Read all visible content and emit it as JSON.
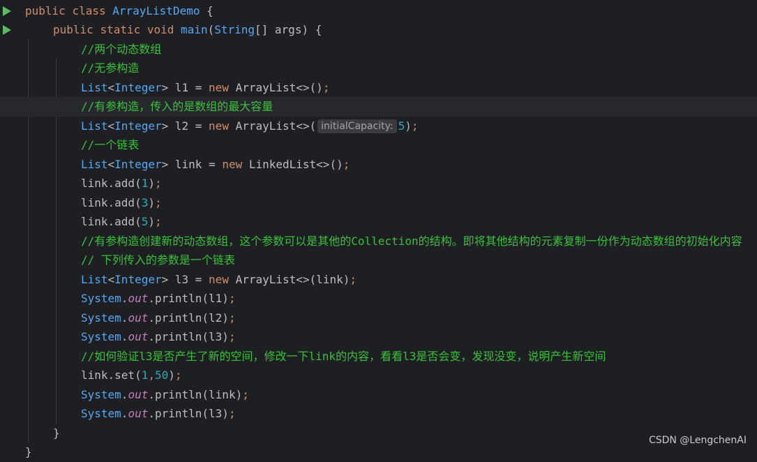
{
  "editor": {
    "lines": [
      [
        {
          "t": "public ",
          "c": "kw"
        },
        {
          "t": "class ",
          "c": "kw"
        },
        {
          "t": "ArrayListDemo",
          "c": "cls"
        },
        {
          "t": " {",
          "c": "punct"
        }
      ],
      [
        {
          "t": "public ",
          "c": "kw"
        },
        {
          "t": "static ",
          "c": "kw"
        },
        {
          "t": "void ",
          "c": "kw"
        },
        {
          "t": "main",
          "c": "fn"
        },
        {
          "t": "(",
          "c": "punct"
        },
        {
          "t": "String",
          "c": "type"
        },
        {
          "t": "[] args) {",
          "c": "punct"
        }
      ],
      [
        {
          "t": "//两个动态数组",
          "c": "cmt"
        }
      ],
      [
        {
          "t": "//无参构造",
          "c": "cmt"
        }
      ],
      [
        {
          "t": "List",
          "c": "type"
        },
        {
          "t": "<",
          "c": "punct"
        },
        {
          "t": "Integer",
          "c": "type"
        },
        {
          "t": "> l1 = ",
          "c": "punct"
        },
        {
          "t": "new ",
          "c": "kw"
        },
        {
          "t": "ArrayList<>()",
          "c": "punct"
        },
        {
          "t": ";",
          "c": "pm"
        }
      ],
      [
        {
          "t": "//有参构造，传入的是数组的最大容量",
          "c": "cmt"
        }
      ],
      [
        {
          "t": "List",
          "c": "type"
        },
        {
          "t": "<",
          "c": "punct"
        },
        {
          "t": "Integer",
          "c": "type"
        },
        {
          "t": "> l2 = ",
          "c": "punct"
        },
        {
          "t": "new ",
          "c": "kw"
        },
        {
          "t": "ArrayList<>(",
          "c": "punct"
        },
        {
          "t": "initialCapacity:",
          "c": "hint"
        },
        {
          "t": "5",
          "c": "num"
        },
        {
          "t": ")",
          "c": "punct"
        },
        {
          "t": ";",
          "c": "pm"
        }
      ],
      [
        {
          "t": "//一个链表",
          "c": "cmt"
        }
      ],
      [
        {
          "t": "List",
          "c": "type"
        },
        {
          "t": "<",
          "c": "punct"
        },
        {
          "t": "Integer",
          "c": "type"
        },
        {
          "t": "> link = ",
          "c": "punct"
        },
        {
          "t": "new ",
          "c": "kw"
        },
        {
          "t": "LinkedList<>()",
          "c": "punct"
        },
        {
          "t": ";",
          "c": "pm"
        }
      ],
      [
        {
          "t": "link.add(",
          "c": "punct"
        },
        {
          "t": "1",
          "c": "num"
        },
        {
          "t": ")",
          "c": "punct"
        },
        {
          "t": ";",
          "c": "pm"
        }
      ],
      [
        {
          "t": "link.add(",
          "c": "punct"
        },
        {
          "t": "3",
          "c": "num"
        },
        {
          "t": ")",
          "c": "punct"
        },
        {
          "t": ";",
          "c": "pm"
        }
      ],
      [
        {
          "t": "link.add(",
          "c": "punct"
        },
        {
          "t": "5",
          "c": "num"
        },
        {
          "t": ")",
          "c": "punct"
        },
        {
          "t": ";",
          "c": "pm"
        }
      ],
      [
        {
          "t": "//有参构造创建新的动态数组，这个参数可以是其他的Collection的结构。即将其他结构的元素复制一份作为动态数组的初始化内容",
          "c": "cmt"
        }
      ],
      [
        {
          "t": "// 下列传入的参数是一个链表",
          "c": "cmt"
        }
      ],
      [
        {
          "t": "List",
          "c": "type"
        },
        {
          "t": "<",
          "c": "punct"
        },
        {
          "t": "Integer",
          "c": "type"
        },
        {
          "t": "> l3 = ",
          "c": "punct"
        },
        {
          "t": "new ",
          "c": "kw"
        },
        {
          "t": "ArrayList<>(link)",
          "c": "punct"
        },
        {
          "t": ";",
          "c": "pm"
        }
      ],
      [
        {
          "t": "System",
          "c": "type"
        },
        {
          "t": ".",
          "c": "punct"
        },
        {
          "t": "out",
          "c": "field"
        },
        {
          "t": ".println(l1)",
          "c": "punct"
        },
        {
          "t": ";",
          "c": "pm"
        }
      ],
      [
        {
          "t": "System",
          "c": "type"
        },
        {
          "t": ".",
          "c": "punct"
        },
        {
          "t": "out",
          "c": "field"
        },
        {
          "t": ".println(l2)",
          "c": "punct"
        },
        {
          "t": ";",
          "c": "pm"
        }
      ],
      [
        {
          "t": "System",
          "c": "type"
        },
        {
          "t": ".",
          "c": "punct"
        },
        {
          "t": "out",
          "c": "field"
        },
        {
          "t": ".println(l3)",
          "c": "punct"
        },
        {
          "t": ";",
          "c": "pm"
        }
      ],
      [
        {
          "t": "//如何验证l3是否产生了新的空间，修改一下link的内容，看看l3是否会变，发现没变，说明产生新空间",
          "c": "cmt"
        }
      ],
      [
        {
          "t": "link.set(",
          "c": "punct"
        },
        {
          "t": "1",
          "c": "num"
        },
        {
          "t": ",",
          "c": "pm"
        },
        {
          "t": "50",
          "c": "num"
        },
        {
          "t": ")",
          "c": "punct"
        },
        {
          "t": ";",
          "c": "pm"
        }
      ],
      [
        {
          "t": "System",
          "c": "type"
        },
        {
          "t": ".",
          "c": "punct"
        },
        {
          "t": "out",
          "c": "field"
        },
        {
          "t": ".println(link)",
          "c": "punct"
        },
        {
          "t": ";",
          "c": "pm"
        }
      ],
      [
        {
          "t": "System",
          "c": "type"
        },
        {
          "t": ".",
          "c": "punct"
        },
        {
          "t": "out",
          "c": "field"
        },
        {
          "t": ".println(l3)",
          "c": "punct"
        },
        {
          "t": ";",
          "c": "pm"
        }
      ],
      [
        {
          "t": "}",
          "c": "punct"
        }
      ],
      [
        {
          "t": "}",
          "c": "punct"
        }
      ]
    ],
    "run_icon_lines": [
      0,
      1
    ],
    "current_line": 5,
    "indent_levels": [
      0,
      1,
      2,
      2,
      2,
      2,
      2,
      2,
      2,
      2,
      2,
      2,
      2,
      2,
      2,
      2,
      2,
      2,
      2,
      2,
      2,
      2,
      1,
      0
    ]
  },
  "watermark": "CSDN @LengchenAI",
  "colors": {
    "background": "#1e1f22",
    "keyword": "#cf8e6d",
    "class_name": "#56a8f5",
    "comment": "#3ac13a",
    "number": "#2aacb8",
    "static_field": "#c77dbb",
    "run_icon": "#5fb865"
  }
}
